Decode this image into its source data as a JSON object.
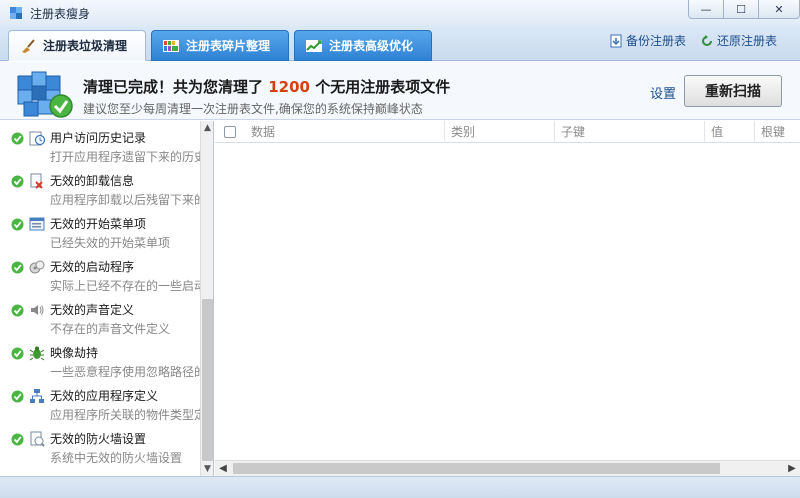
{
  "window": {
    "title": "注册表瘦身",
    "minimize_glyph": "—",
    "maximize_glyph": "☐",
    "close_glyph": "✕"
  },
  "tabs": [
    {
      "label": "注册表垃圾清理",
      "icon": "broom-icon",
      "active": true
    },
    {
      "label": "注册表碎片整理",
      "icon": "defrag-icon",
      "active": false
    },
    {
      "label": "注册表高级优化",
      "icon": "chart-icon",
      "active": false
    }
  ],
  "toolbar_links": {
    "backup": "备份注册表",
    "restore": "还原注册表"
  },
  "summary": {
    "done_prefix": "清理已完成！共为您清理了 ",
    "count": "1200",
    "done_suffix": " 个无用注册表项文件",
    "hint": "建议您至少每周清理一次注册表文件,确保您的系统保持巅峰状态",
    "settings_label": "设置",
    "rescan_label": "重新扫描"
  },
  "categories": [
    {
      "title": "用户访问历史记录",
      "desc": "打开应用程序遗留下来的历史",
      "icon": "history-clock-icon"
    },
    {
      "title": "无效的卸载信息",
      "desc": "应用程序卸载以后残留下来的",
      "icon": "uninstall-icon"
    },
    {
      "title": "无效的开始菜单项",
      "desc": "已经失效的开始菜单项",
      "icon": "start-menu-icon"
    },
    {
      "title": "无效的启动程序",
      "desc": "实际上已经不存在的一些启动",
      "icon": "startup-program-icon"
    },
    {
      "title": "无效的声音定义",
      "desc": "不存在的声音文件定义",
      "icon": "speaker-icon"
    },
    {
      "title": "映像劫持",
      "desc": "一些恶意程序使用忽略路径的",
      "icon": "bug-icon"
    },
    {
      "title": "无效的应用程序定义",
      "desc": "应用程序所关联的物件类型定",
      "icon": "app-definition-icon"
    },
    {
      "title": "无效的防火墙设置",
      "desc": "系统中无效的防火墙设置",
      "icon": "firewall-icon"
    }
  ],
  "table": {
    "columns": [
      "数据",
      "类别",
      "子键",
      "值",
      "根键"
    ]
  },
  "colors": {
    "accent_blue": "#2f82d4",
    "count_red": "#d4420c",
    "check_green": "#4bb543"
  }
}
